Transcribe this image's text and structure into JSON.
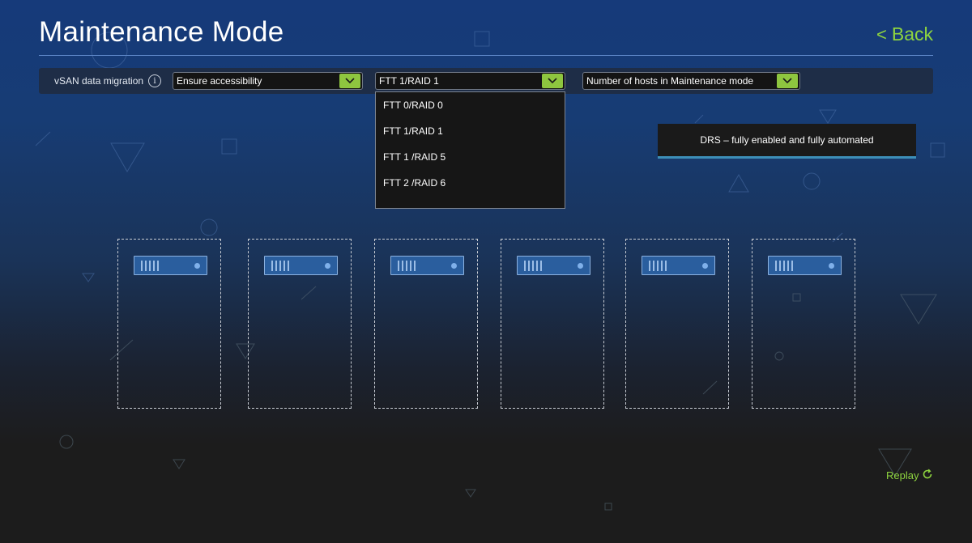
{
  "colors": {
    "accent_green": "#8ec63f",
    "link_green": "#8ed43f",
    "background_top": "#163a7a",
    "background_bottom": "#1c1c1c",
    "server_blue": "#2a5e9e",
    "drs_underline": "#3d8fb8"
  },
  "header": {
    "title": "Maintenance Mode",
    "back_label": "Back",
    "back_icon": "chevron-left-icon"
  },
  "toolbar": {
    "label": "vSAN data migration",
    "info_icon_glyph": "i",
    "migration_select": {
      "value": "Ensure accessibility",
      "button_icon": "chevron-down-icon"
    },
    "ftt_select": {
      "value": "FTT 1/RAID 1",
      "button_icon": "chevron-down-icon",
      "expanded": true
    },
    "hosts_select": {
      "value": "Number of hosts in Maintenance mode",
      "button_icon": "chevron-down-icon"
    }
  },
  "ftt_dropdown": {
    "options": [
      "FTT 0/RAID 0",
      "FTT 1/RAID 1",
      "FTT 1 /RAID 5",
      "FTT 2 /RAID 6"
    ]
  },
  "drs_status": {
    "text": "DRS – fully enabled and fully automated"
  },
  "hosts": [
    {
      "icon": "server-icon"
    },
    {
      "icon": "server-icon"
    },
    {
      "icon": "server-icon"
    },
    {
      "icon": "server-icon"
    },
    {
      "icon": "server-icon"
    },
    {
      "icon": "server-icon"
    }
  ],
  "footer": {
    "replay_label": "Replay",
    "replay_icon": "refresh-icon"
  }
}
